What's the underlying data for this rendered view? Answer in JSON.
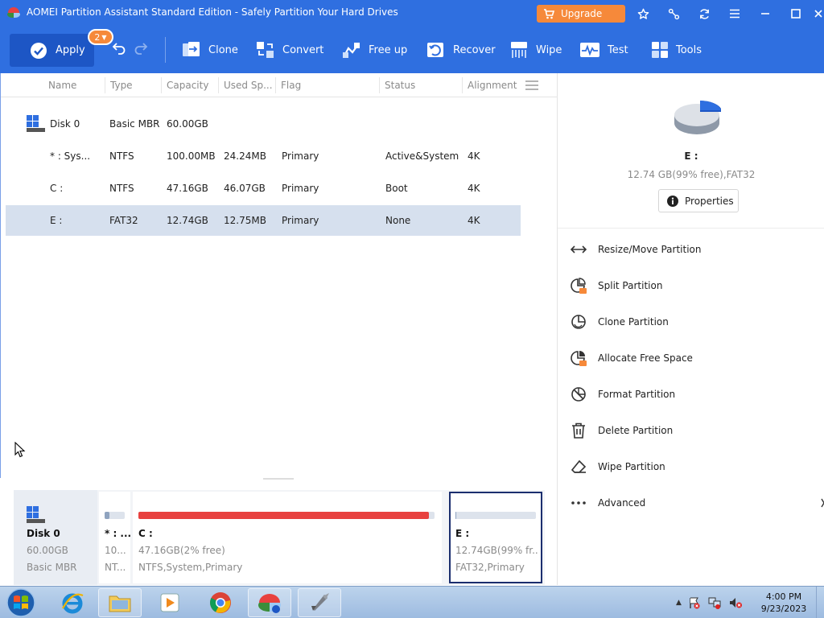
{
  "titlebar": {
    "title": "AOMEI Partition Assistant Standard Edition - Safely Partition Your Hard Drives",
    "upgrade_label": "Upgrade"
  },
  "toolbar": {
    "apply_label": "Apply",
    "pending_count": "2",
    "tools": [
      {
        "label": "Clone",
        "icon": "clone-icon"
      },
      {
        "label": "Convert",
        "icon": "convert-icon"
      },
      {
        "label": "Free up",
        "icon": "free-up-icon"
      },
      {
        "label": "Recover",
        "icon": "recover-icon"
      },
      {
        "label": "Wipe",
        "icon": "wipe-icon"
      },
      {
        "label": "Test",
        "icon": "test-icon"
      },
      {
        "label": "Tools",
        "icon": "tools-icon"
      }
    ]
  },
  "table": {
    "columns": [
      "Name",
      "Type",
      "Capacity",
      "Used Sp...",
      "Flag",
      "Status",
      "Alignment"
    ],
    "rows": [
      {
        "name": "Disk 0",
        "type": "Basic MBR",
        "capacity": "60.00GB",
        "used": "",
        "flag": "",
        "status": "",
        "alignment": ""
      },
      {
        "name": "* : Sys...",
        "type": "NTFS",
        "capacity": "100.00MB",
        "used": "24.24MB",
        "flag": "Primary",
        "status": "Active&System",
        "alignment": "4K"
      },
      {
        "name": "C :",
        "type": "NTFS",
        "capacity": "47.16GB",
        "used": "46.07GB",
        "flag": "Primary",
        "status": "Boot",
        "alignment": "4K"
      },
      {
        "name": "E :",
        "type": "FAT32",
        "capacity": "12.74GB",
        "used": "12.75MB",
        "flag": "Primary",
        "status": "None",
        "alignment": "4K"
      }
    ]
  },
  "diskmap": {
    "disk_name": "Disk 0",
    "disk_size": "60.00GB",
    "disk_type": "Basic MBR",
    "partitions": [
      {
        "name": "* : ...",
        "size": "10...",
        "fs": "NT...",
        "used_fraction": 0.24
      },
      {
        "name": "C :",
        "size": "47.16GB(2% free)",
        "fs": "NTFS,System,Primary",
        "used_fraction": 0.98
      },
      {
        "name": "E :",
        "size": "12.74GB(99% fr...",
        "fs": "FAT32,Primary",
        "used_fraction": 0.01
      }
    ]
  },
  "panel": {
    "partition": "E :",
    "info": "12.74 GB(99% free),FAT32",
    "properties_label": "Properties",
    "operations": [
      {
        "label": "Resize/Move Partition",
        "icon": "resize-icon"
      },
      {
        "label": "Split Partition",
        "icon": "split-icon"
      },
      {
        "label": "Clone Partition",
        "icon": "clone-partition-icon"
      },
      {
        "label": "Allocate Free Space",
        "icon": "allocate-icon"
      },
      {
        "label": "Format Partition",
        "icon": "format-icon"
      },
      {
        "label": "Delete Partition",
        "icon": "delete-icon"
      },
      {
        "label": "Wipe Partition",
        "icon": "eraser-icon"
      },
      {
        "label": "Advanced",
        "icon": "more-icon"
      }
    ]
  },
  "taskbar": {
    "time": "4:00 PM",
    "date": "9/23/2023"
  },
  "colors": {
    "accent": "#2f6fe0",
    "upgrade": "#f6893a",
    "used_bar": "#e8413f",
    "free_bar": "#dde3ec",
    "selected_row": "#d6e0ee"
  }
}
